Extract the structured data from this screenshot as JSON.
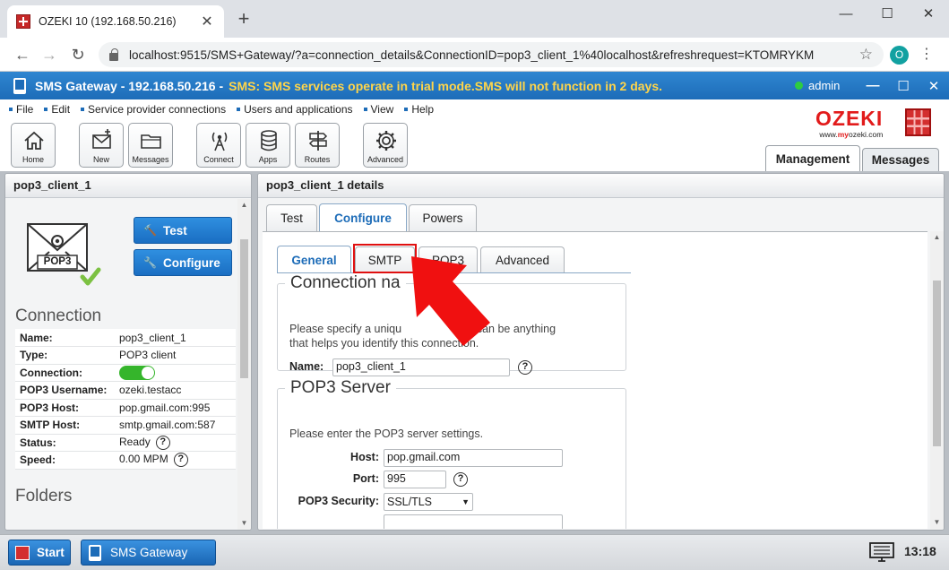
{
  "browser": {
    "tab_title": "OZEKI 10 (192.168.50.216)",
    "tab_close": "✕",
    "new_tab": "+",
    "url": "localhost:9515/SMS+Gateway/?a=connection_details&ConnectionID=pop3_client_1%40localhost&refreshrequest=KTOMRYKM",
    "profile_initial": "O"
  },
  "app": {
    "title": "SMS Gateway - 192.168.50.216 -",
    "trial_notice": "SMS: SMS services operate in trial mode.SMS will not function in 2 days.",
    "user": "admin"
  },
  "menu": [
    "File",
    "Edit",
    "Service provider connections",
    "Users and applications",
    "View",
    "Help"
  ],
  "toolbar": {
    "home": "Home",
    "new": "New",
    "messages": "Messages",
    "connect": "Connect",
    "apps": "Apps",
    "routes": "Routes",
    "advanced": "Advanced"
  },
  "logo": {
    "word": "OZEKI",
    "url_prefix": "www.",
    "url_brand": "my",
    "url_suffix": "ozeki.com"
  },
  "mode_tabs": {
    "management": "Management",
    "messages": "Messages"
  },
  "left": {
    "header": "pop3_client_1",
    "icon_label": "POP3",
    "test_button": "Test",
    "configure_button": "Configure",
    "connection_title": "Connection",
    "folders_title": "Folders",
    "rows": [
      {
        "key": "Name:",
        "value": "pop3_client_1"
      },
      {
        "key": "Type:",
        "value": "POP3 client"
      },
      {
        "key": "Connection:",
        "value": ""
      },
      {
        "key": "POP3 Username:",
        "value": "ozeki.testacc"
      },
      {
        "key": "POP3 Host:",
        "value": "pop.gmail.com:995"
      },
      {
        "key": "SMTP Host:",
        "value": "smtp.gmail.com:587"
      },
      {
        "key": "Status:",
        "value": "Ready"
      },
      {
        "key": "Speed:",
        "value": "0.00 MPM"
      }
    ]
  },
  "right": {
    "header": "pop3_client_1 details",
    "tabs": [
      "Test",
      "Configure",
      "Powers"
    ],
    "subtabs": [
      "General",
      "SMTP",
      "POP3",
      "Advanced"
    ],
    "connection_name": {
      "legend": "Connection na",
      "desc_line1": "Please specify a uniqu",
      "desc_line1_end": "s can be anything",
      "desc_line2": "that helps you identify this connection.",
      "name_label": "Name:",
      "name_value": "pop3_client_1"
    },
    "pop3_server": {
      "legend": "POP3 Server",
      "desc": "Please enter the POP3 server settings.",
      "host_label": "Host:",
      "host_value": "pop.gmail.com",
      "port_label": "Port:",
      "port_value": "995",
      "security_label": "POP3 Security:",
      "security_value": "SSL/TLS"
    }
  },
  "help_glyph": "?",
  "taskbar": {
    "start": "Start",
    "app": "SMS Gateway",
    "clock": "13:18"
  },
  "colors": {
    "accent": "#1d6cb8",
    "trial": "#ffd54a",
    "ozeki_red": "#e21b1b",
    "highlight": "#e01010"
  }
}
